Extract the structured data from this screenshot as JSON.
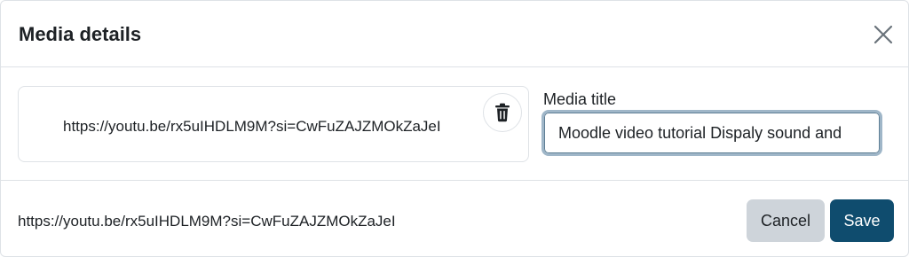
{
  "header": {
    "title": "Media details"
  },
  "body": {
    "media_url": "https://youtu.be/rx5uIHDLM9M?si=CwFuZAJZMOkZaJeI",
    "title_label": "Media title",
    "title_value": "Moodle video tutorial Dispaly sound and"
  },
  "footer": {
    "url": "https://youtu.be/rx5uIHDLM9M?si=CwFuZAJZMOkZaJeI",
    "cancel_label": "Cancel",
    "save_label": "Save"
  },
  "icons": {
    "close": "close-icon",
    "delete": "trash-icon"
  },
  "colors": {
    "primary": "#0f4c6e",
    "secondary": "#ced4da",
    "border": "#dee2e6",
    "focus": "#9fb6c8"
  }
}
